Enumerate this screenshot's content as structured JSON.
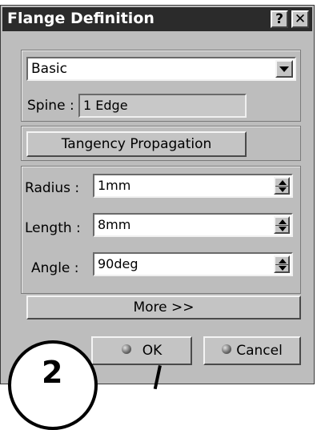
{
  "dialog": {
    "title": "Flange Definition",
    "help_label": "?",
    "close_label": "✕"
  },
  "mode": {
    "selected": "Basic"
  },
  "spine": {
    "label": "Spine :",
    "value": "1 Edge"
  },
  "tangency_button": "Tangency Propagation",
  "params": {
    "radius": {
      "label": "Radius :",
      "value": "1mm"
    },
    "length": {
      "label": "Length :",
      "value": "8mm"
    },
    "angle": {
      "label": "Angle :",
      "value": "90deg"
    }
  },
  "more_button": "More >>",
  "ok_button": "OK",
  "cancel_button": "Cancel",
  "callout": {
    "number": "2"
  }
}
